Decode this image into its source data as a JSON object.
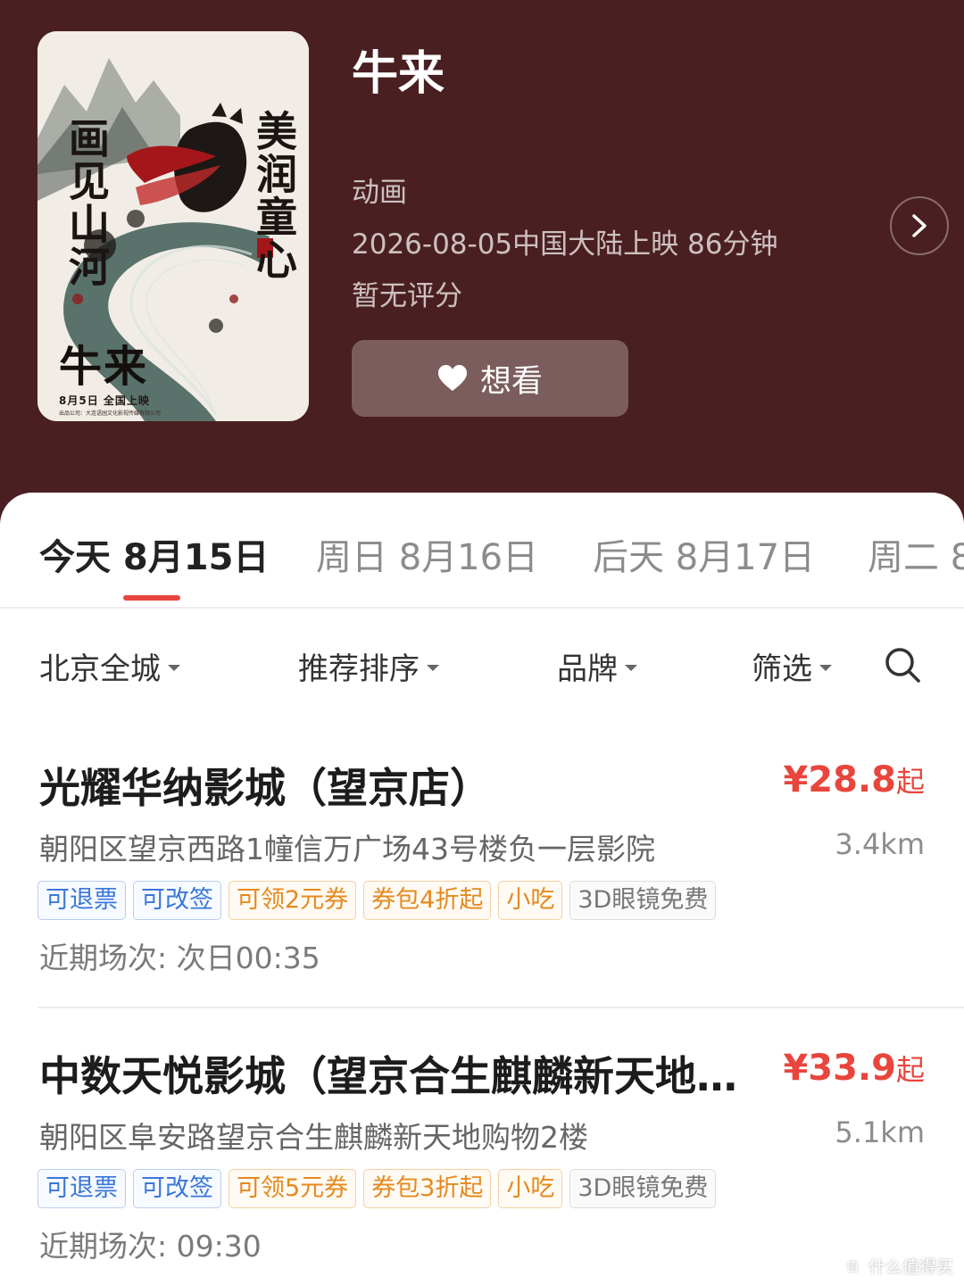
{
  "movie": {
    "title": "牛来",
    "genre": "动画",
    "release": "2026-08-05中国大陆上映 86分钟",
    "rating": "暂无评分",
    "want_label": "想看",
    "poster": {
      "left_text": "画见山河",
      "right_text": "美润童心",
      "title": "牛来",
      "date": "8月5日  全国上映",
      "company": "出品公司：大连语园文化影视传媒有限公司"
    }
  },
  "date_tabs": [
    {
      "label": "今天 8月15日",
      "active": true
    },
    {
      "label": "周日 8月16日",
      "active": false
    },
    {
      "label": "后天 8月17日",
      "active": false
    },
    {
      "label": "周二 8",
      "active": false
    }
  ],
  "filters": [
    {
      "label": "北京全城"
    },
    {
      "label": "推荐排序"
    },
    {
      "label": "品牌"
    },
    {
      "label": "筛选"
    }
  ],
  "cinemas": [
    {
      "name": "光耀华纳影城（望京店）",
      "price": "¥28.8",
      "price_suffix": "起",
      "address": "朝阳区望京西路1幢信万广场43号楼负一层影院",
      "distance": "3.4km",
      "tags": [
        {
          "label": "可退票",
          "style": "blue"
        },
        {
          "label": "可改签",
          "style": "blue"
        },
        {
          "label": "可领2元券",
          "style": "orange"
        },
        {
          "label": "券包4折起",
          "style": "orange"
        },
        {
          "label": "小吃",
          "style": "orange"
        },
        {
          "label": "3D眼镜免费",
          "style": "gray"
        }
      ],
      "showtime": "近期场次: 次日00:35"
    },
    {
      "name": "中数天悦影城（望京合生麒麟新天地店）",
      "price": "¥33.9",
      "price_suffix": "起",
      "address": "朝阳区阜安路望京合生麒麟新天地购物2楼",
      "distance": "5.1km",
      "tags": [
        {
          "label": "可退票",
          "style": "blue"
        },
        {
          "label": "可改签",
          "style": "blue"
        },
        {
          "label": "可领5元券",
          "style": "orange"
        },
        {
          "label": "券包3折起",
          "style": "orange"
        },
        {
          "label": "小吃",
          "style": "orange"
        },
        {
          "label": "3D眼镜免费",
          "style": "gray"
        }
      ],
      "showtime": "近期场次: 09:30"
    }
  ],
  "watermark": "什么值得买",
  "colors": {
    "header_bg": "#4a1f21",
    "accent_red": "#e8453c",
    "tag_blue": "#3a77d8",
    "tag_orange": "#e48a1e"
  }
}
